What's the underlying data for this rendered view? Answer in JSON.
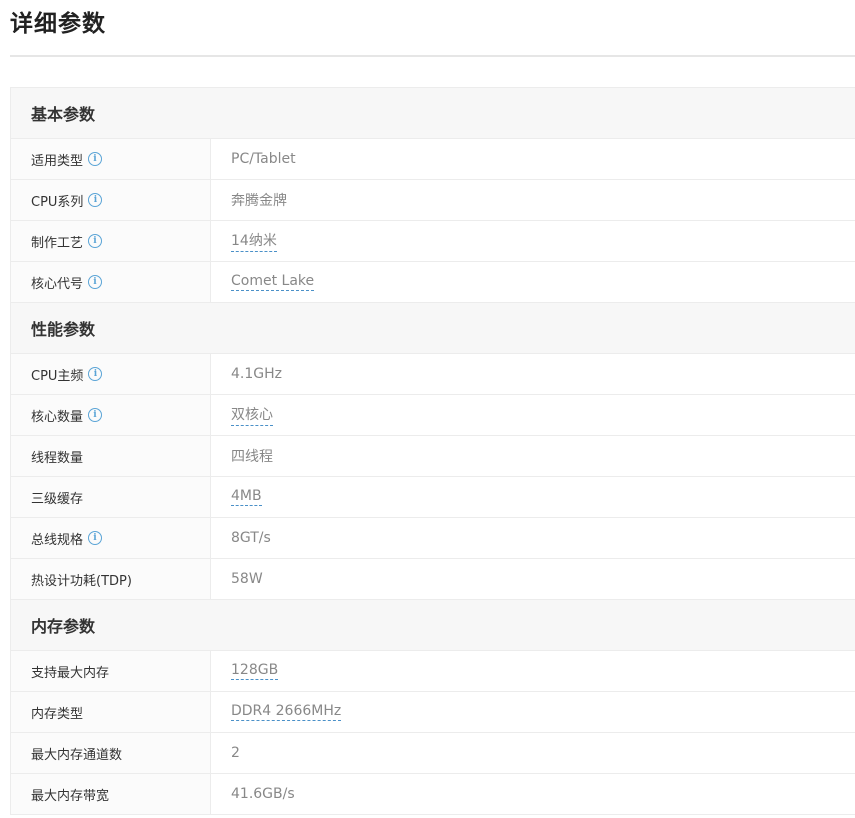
{
  "page_title": "详细参数",
  "sections": [
    {
      "title": "基本参数",
      "rows": [
        {
          "label": "适用类型",
          "has_info": true,
          "value": "PC/Tablet",
          "linked": false
        },
        {
          "label": "CPU系列",
          "has_info": true,
          "value": "奔腾金牌",
          "linked": false
        },
        {
          "label": "制作工艺",
          "has_info": true,
          "value": "14纳米",
          "linked": true
        },
        {
          "label": "核心代号",
          "has_info": true,
          "value": "Comet Lake",
          "linked": true
        }
      ]
    },
    {
      "title": "性能参数",
      "rows": [
        {
          "label": "CPU主频",
          "has_info": true,
          "value": "4.1GHz",
          "linked": false
        },
        {
          "label": "核心数量",
          "has_info": true,
          "value": "双核心",
          "linked": true
        },
        {
          "label": "线程数量",
          "has_info": false,
          "value": "四线程",
          "linked": false
        },
        {
          "label": "三级缓存",
          "has_info": false,
          "value": "4MB",
          "linked": true
        },
        {
          "label": "总线规格",
          "has_info": true,
          "value": "8GT/s",
          "linked": false
        },
        {
          "label": "热设计功耗(TDP)",
          "has_info": false,
          "value": "58W",
          "linked": false
        }
      ]
    },
    {
      "title": "内存参数",
      "rows": [
        {
          "label": "支持最大内存",
          "has_info": false,
          "value": "128GB",
          "linked": true
        },
        {
          "label": "内存类型",
          "has_info": false,
          "value": "DDR4 2666MHz",
          "linked": true
        },
        {
          "label": "最大内存通道数",
          "has_info": false,
          "value": "2",
          "linked": false
        },
        {
          "label": "最大内存带宽",
          "has_info": false,
          "value": "41.6GB/s",
          "linked": false
        }
      ]
    }
  ],
  "info_icon": {
    "name": "info-icon",
    "glyph": "i",
    "color": "#5aa4d6"
  },
  "colors": {
    "section_bg": "#f7f7f7",
    "border": "#ececec",
    "link_underline": "#4a90c8",
    "value_text": "#888888"
  }
}
